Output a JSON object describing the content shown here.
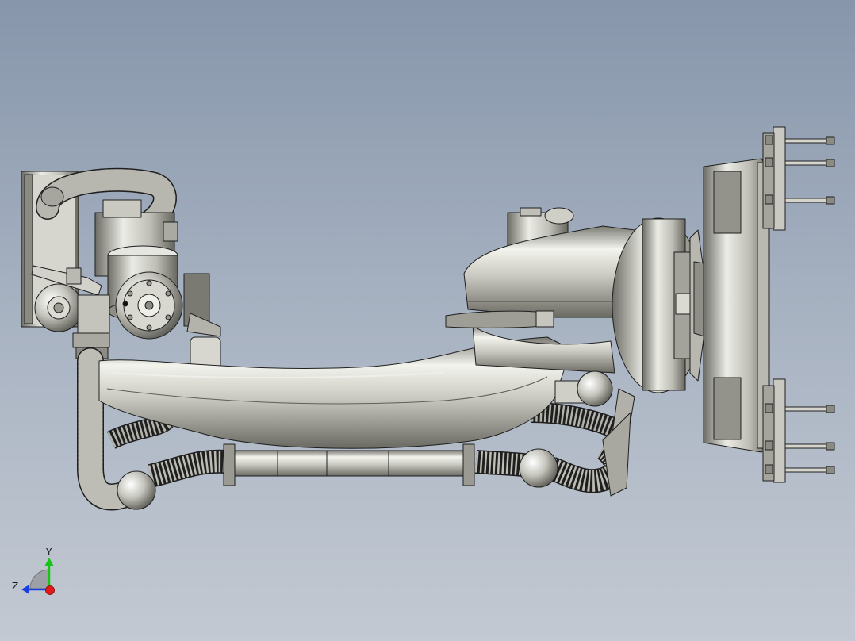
{
  "app": {
    "title": ""
  },
  "viewport": {
    "background_top": "#8796ab",
    "background_bottom": "#c3c9d2",
    "model_fill": "#c8c8c0",
    "model_dark": "#6f6f68",
    "model_light": "#f2f2ec",
    "edge_color": "#1f1f1f"
  },
  "triad": {
    "y_label": "Y",
    "z_label": "Z",
    "y_color": "#17c417",
    "z_color": "#1a3fe0",
    "x_color": "#e01a1a"
  }
}
